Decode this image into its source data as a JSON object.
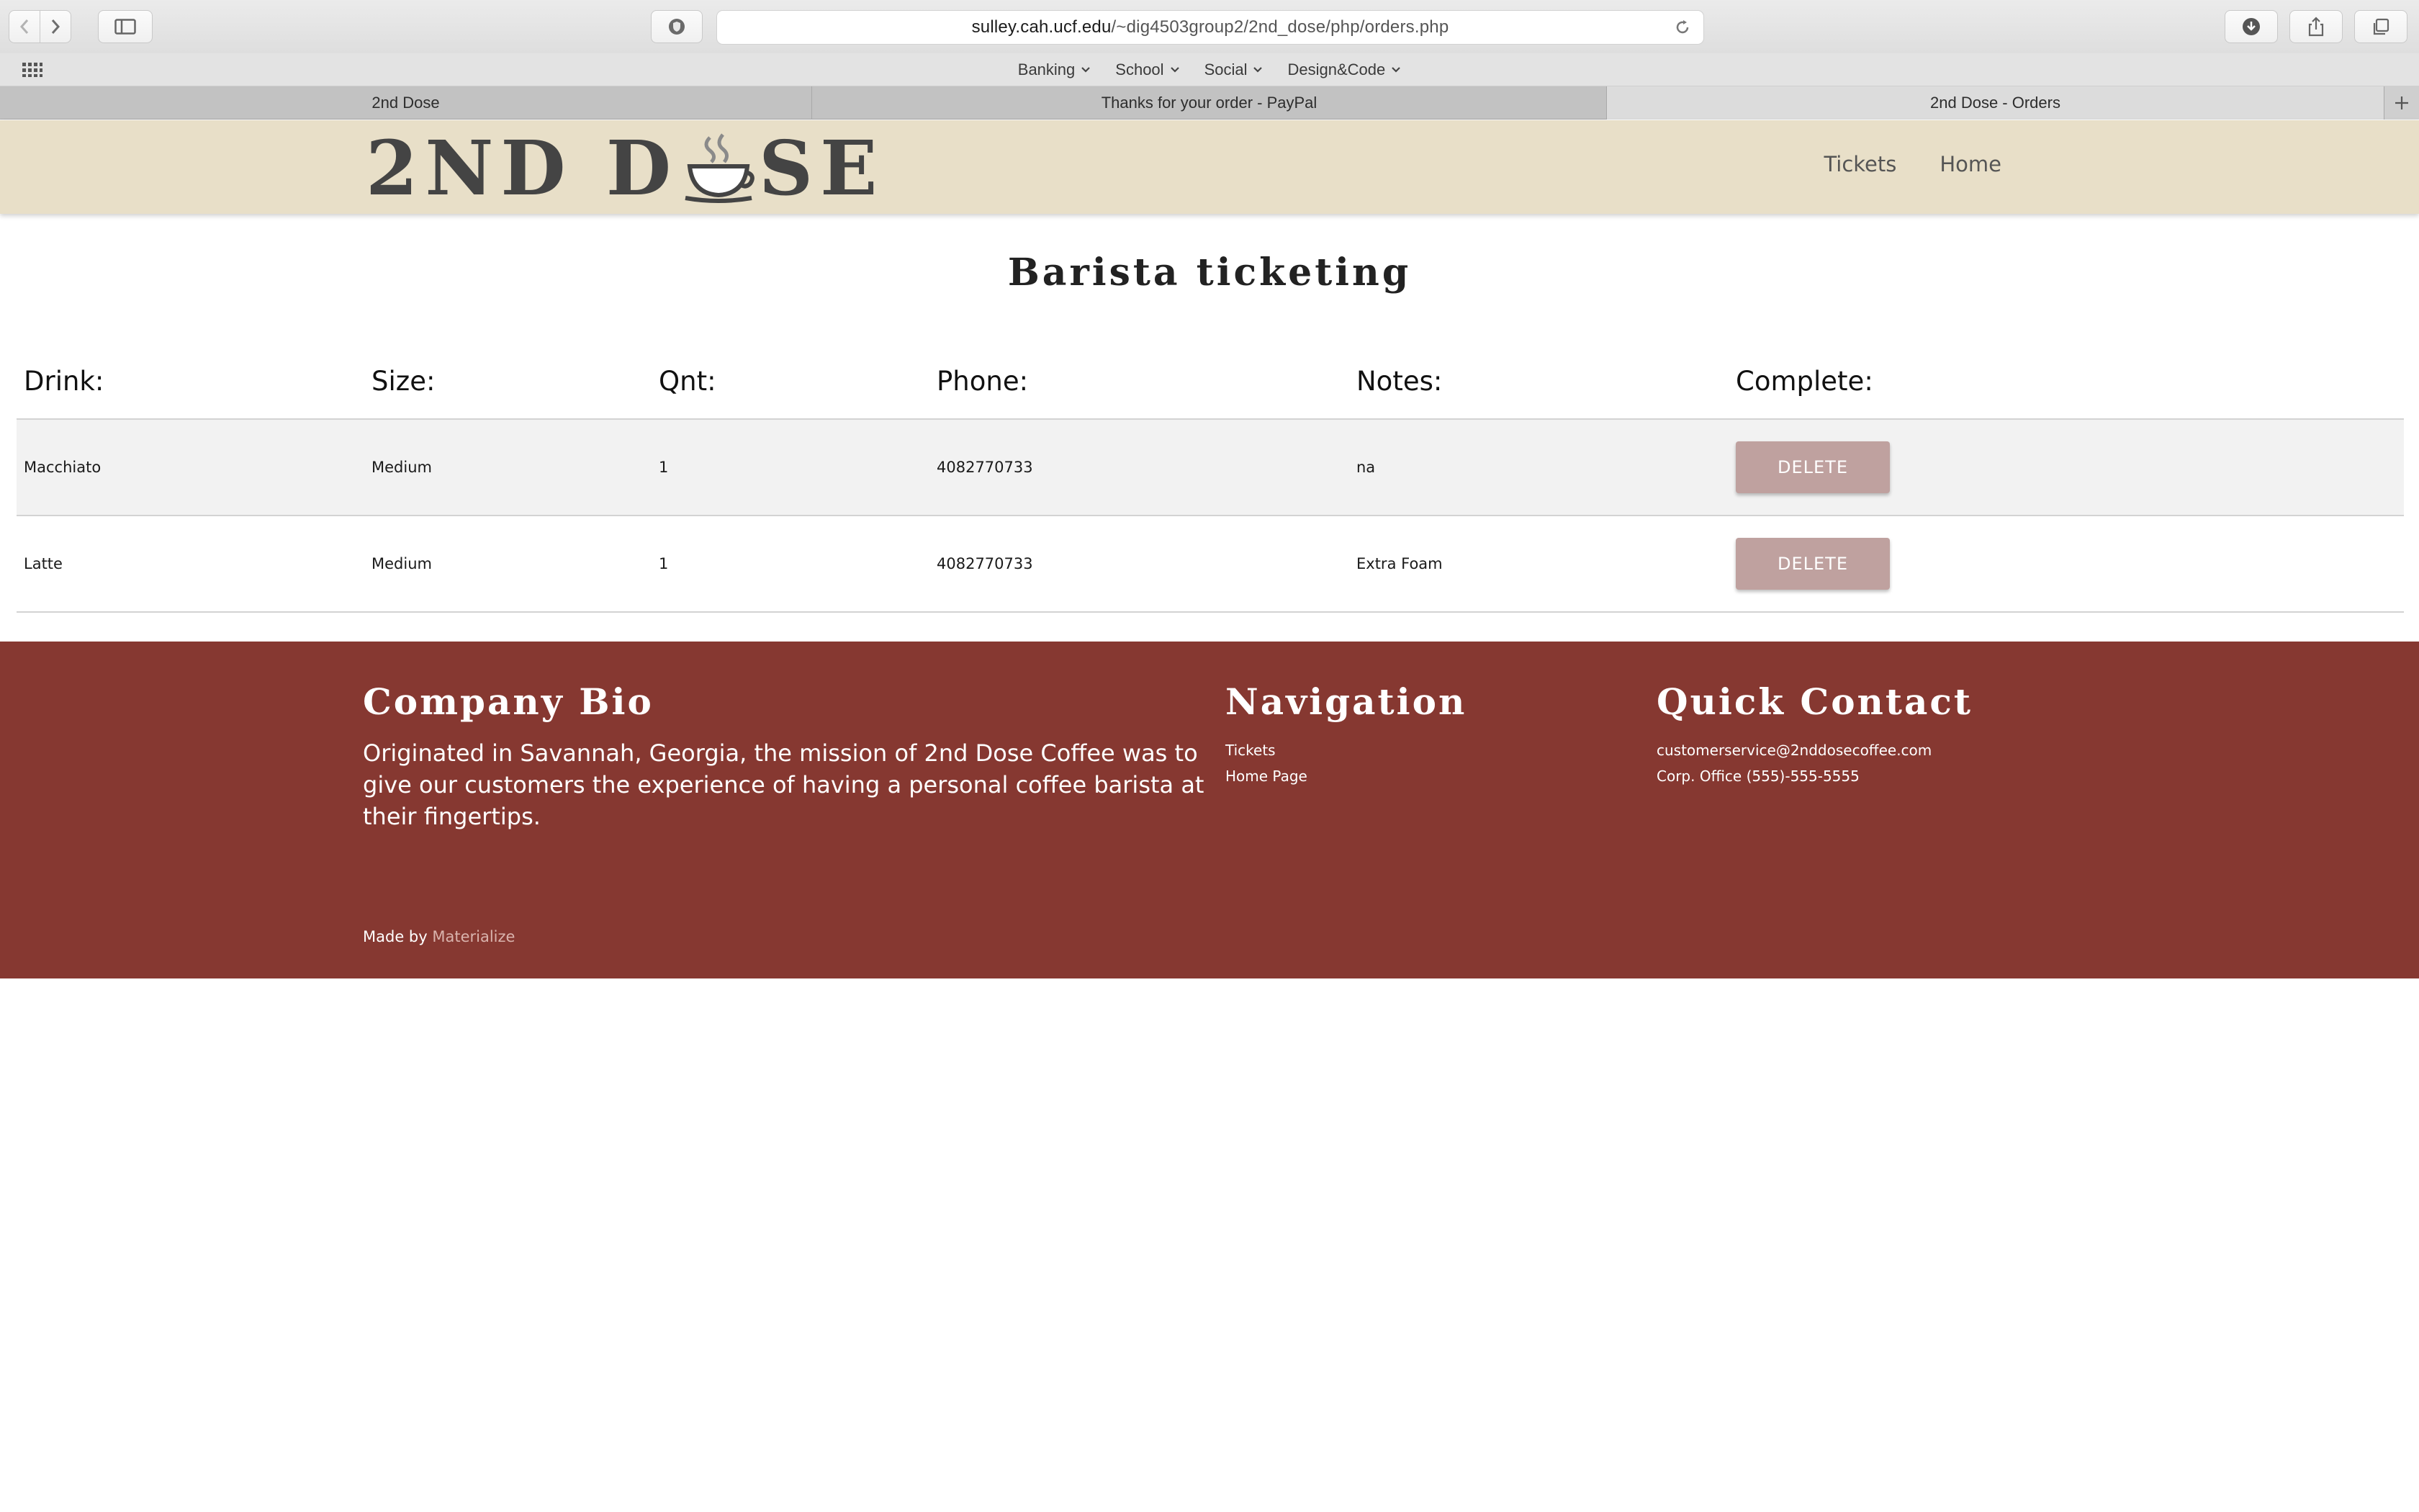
{
  "browser": {
    "url_host": "sulley.cah.ucf.edu",
    "url_path": "/~dig4503group2/2nd_dose/php/orders.php",
    "favorites": [
      {
        "label": "Banking"
      },
      {
        "label": "School"
      },
      {
        "label": "Social"
      },
      {
        "label": "Design&Code"
      }
    ],
    "tabs": [
      {
        "label": "2nd Dose"
      },
      {
        "label": "Thanks for your order - PayPal"
      },
      {
        "label": "2nd Dose - Orders"
      }
    ]
  },
  "header": {
    "logo_left": "2ND D",
    "logo_right": "SE",
    "nav": [
      {
        "label": "Tickets"
      },
      {
        "label": "Home"
      }
    ]
  },
  "main": {
    "title": "Barista ticketing",
    "columns": [
      "Drink:",
      "Size:",
      "Qnt:",
      "Phone:",
      "Notes:",
      "Complete:"
    ],
    "rows": [
      {
        "drink": "Macchiato",
        "size": "Medium",
        "qnt": "1",
        "phone": "4082770733",
        "notes": "na",
        "action": "DELETE"
      },
      {
        "drink": "Latte",
        "size": "Medium",
        "qnt": "1",
        "phone": "4082770733",
        "notes": "Extra Foam",
        "action": "DELETE"
      }
    ]
  },
  "footer": {
    "bio_title": "Company Bio",
    "bio_text": "Originated in Savannah, Georgia, the mission of 2nd Dose Coffee was to give our customers the experience of having a personal coffee barista at their fingertips.",
    "nav_title": "Navigation",
    "nav_links": [
      {
        "label": "Tickets"
      },
      {
        "label": "Home Page"
      }
    ],
    "contact_title": "Quick Contact",
    "contact_email": "customerservice@2nddosecoffee.com",
    "contact_phone": "Corp. Office (555)-555-5555",
    "made_by_prefix": "Made by",
    "made_by_link": "Materialize"
  },
  "colors": {
    "header_bg": "#e8dfc8",
    "footer_bg": "#863831",
    "delete_button": "#bfa19f"
  }
}
